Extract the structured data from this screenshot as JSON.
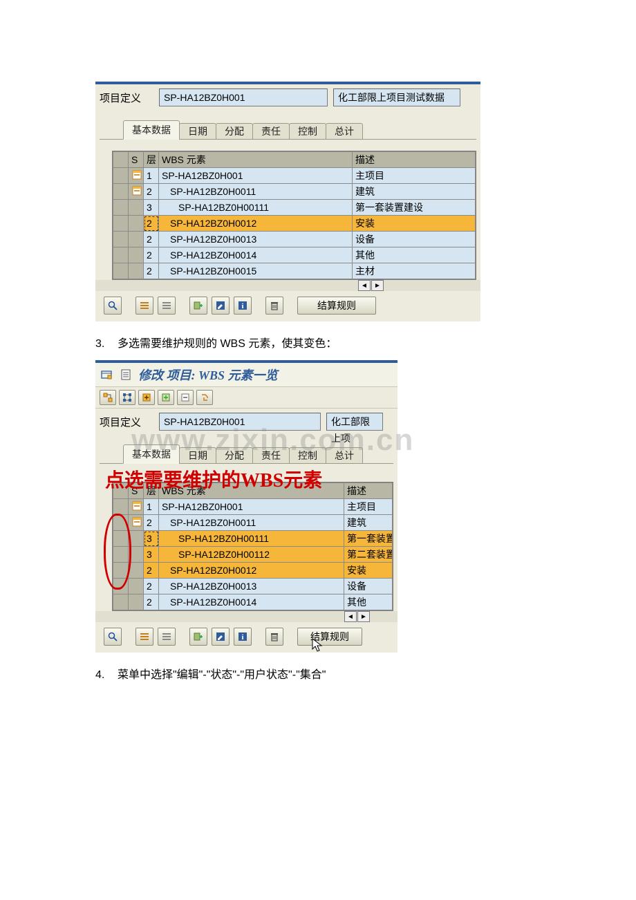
{
  "panel1": {
    "proj_label": "项目定义",
    "proj_code": "SP-HA12BZ0H001",
    "proj_desc": "化工部限上项目测试数据",
    "tabs": [
      "基本数据",
      "日期",
      "分配",
      "责任",
      "控制",
      "总计"
    ],
    "active_tab": 0,
    "headers": {
      "s": "S",
      "level": "层",
      "wbs": "WBS 元素",
      "desc": "描述"
    },
    "rows": [
      {
        "exp": true,
        "level": "1",
        "wbs": "SP-HA12BZ0H001",
        "desc": "主项目",
        "indent": 0,
        "hl": false
      },
      {
        "exp": true,
        "level": "2",
        "wbs": "SP-HA12BZ0H0011",
        "desc": "建筑",
        "indent": 1,
        "hl": false
      },
      {
        "exp": false,
        "level": "3",
        "wbs": "SP-HA12BZ0H00111",
        "desc": "第一套装置建设",
        "indent": 2,
        "hl": false
      },
      {
        "exp": false,
        "level": "2",
        "wbs": "SP-HA12BZ0H0012",
        "desc": "安装",
        "indent": 1,
        "hl": true,
        "dash": true
      },
      {
        "exp": false,
        "level": "2",
        "wbs": "SP-HA12BZ0H0013",
        "desc": "设备",
        "indent": 1,
        "hl": false
      },
      {
        "exp": false,
        "level": "2",
        "wbs": "SP-HA12BZ0H0014",
        "desc": "其他",
        "indent": 1,
        "hl": false
      },
      {
        "exp": false,
        "level": "2",
        "wbs": "SP-HA12BZ0H0015",
        "desc": "主材",
        "indent": 1,
        "hl": false
      }
    ],
    "rule_btn": "结算规则"
  },
  "step3": {
    "num": "3.",
    "text": "多选需要维护规则的 WBS 元素，使其变色："
  },
  "panel2": {
    "title": "修改 项目: WBS 元素一览",
    "proj_label": "项目定义",
    "proj_code": "SP-HA12BZ0H001",
    "proj_desc": "化工部限上项",
    "tabs": [
      "基本数据",
      "日期",
      "分配",
      "责任",
      "控制",
      "总计"
    ],
    "active_tab": 0,
    "annotation": "点选需要维护的WBS元素",
    "headers": {
      "s": "S",
      "level": "层",
      "wbs": "WBS 元素",
      "desc": "描述"
    },
    "rows": [
      {
        "exp": true,
        "level": "1",
        "wbs": "SP-HA12BZ0H001",
        "desc": "主项目",
        "indent": 0,
        "hl": false
      },
      {
        "exp": true,
        "level": "2",
        "wbs": "SP-HA12BZ0H0011",
        "desc": "建筑",
        "indent": 1,
        "hl": false
      },
      {
        "exp": false,
        "level": "3",
        "wbs": "SP-HA12BZ0H00111",
        "desc": "第一套装置",
        "indent": 2,
        "hl": true,
        "dash": true
      },
      {
        "exp": false,
        "level": "3",
        "wbs": "SP-HA12BZ0H00112",
        "desc": "第二套装置",
        "indent": 2,
        "hl": true
      },
      {
        "exp": false,
        "level": "2",
        "wbs": "SP-HA12BZ0H0012",
        "desc": "安装",
        "indent": 1,
        "hl": true
      },
      {
        "exp": false,
        "level": "2",
        "wbs": "SP-HA12BZ0H0013",
        "desc": "设备",
        "indent": 1,
        "hl": false
      },
      {
        "exp": false,
        "level": "2",
        "wbs": "SP-HA12BZ0H0014",
        "desc": "其他",
        "indent": 1,
        "hl": false
      }
    ],
    "rule_btn": "结算规则"
  },
  "step4": {
    "num": "4.",
    "text": "菜单中选择\"编辑\"-\"状态\"-\"用户状态\"-\"集合\""
  },
  "watermark": "www.zixin.com.cn"
}
